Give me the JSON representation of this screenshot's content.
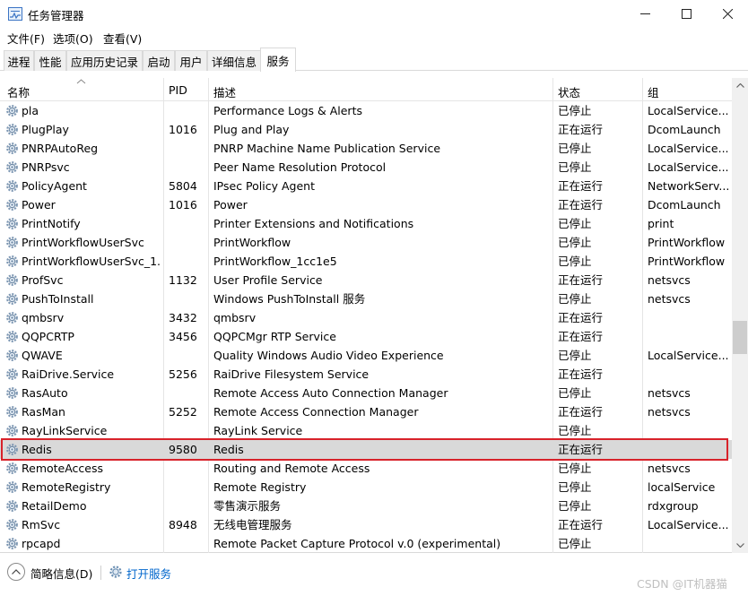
{
  "window": {
    "title": "任务管理器",
    "controls": [
      "minimize",
      "maximize",
      "close"
    ]
  },
  "menu": [
    "文件(F)",
    "选项(O)",
    "查看(V)"
  ],
  "tabs": [
    "进程",
    "性能",
    "应用历史记录",
    "启动",
    "用户",
    "详细信息",
    "服务"
  ],
  "active_tab": "服务",
  "table": {
    "columns": [
      "名称",
      "PID",
      "描述",
      "状态",
      "组"
    ],
    "sort_column": "名称",
    "rows": [
      {
        "name": "pla",
        "pid": "",
        "desc": "Performance Logs & Alerts",
        "status": "已停止",
        "group": "LocalService..."
      },
      {
        "name": "PlugPlay",
        "pid": "1016",
        "desc": "Plug and Play",
        "status": "正在运行",
        "group": "DcomLaunch"
      },
      {
        "name": "PNRPAutoReg",
        "pid": "",
        "desc": "PNRP Machine Name Publication Service",
        "status": "已停止",
        "group": "LocalService..."
      },
      {
        "name": "PNRPsvc",
        "pid": "",
        "desc": "Peer Name Resolution Protocol",
        "status": "已停止",
        "group": "LocalService..."
      },
      {
        "name": "PolicyAgent",
        "pid": "5804",
        "desc": "IPsec Policy Agent",
        "status": "正在运行",
        "group": "NetworkServ..."
      },
      {
        "name": "Power",
        "pid": "1016",
        "desc": "Power",
        "status": "正在运行",
        "group": "DcomLaunch"
      },
      {
        "name": "PrintNotify",
        "pid": "",
        "desc": "Printer Extensions and Notifications",
        "status": "已停止",
        "group": "print"
      },
      {
        "name": "PrintWorkflowUserSvc",
        "pid": "",
        "desc": "PrintWorkflow",
        "status": "已停止",
        "group": "PrintWorkflow"
      },
      {
        "name": "PrintWorkflowUserSvc_1...",
        "pid": "",
        "desc": "PrintWorkflow_1cc1e5",
        "status": "已停止",
        "group": "PrintWorkflow"
      },
      {
        "name": "ProfSvc",
        "pid": "1132",
        "desc": "User Profile Service",
        "status": "正在运行",
        "group": "netsvcs"
      },
      {
        "name": "PushToInstall",
        "pid": "",
        "desc": "Windows PushToInstall 服务",
        "status": "已停止",
        "group": "netsvcs"
      },
      {
        "name": "qmbsrv",
        "pid": "3432",
        "desc": "qmbsrv",
        "status": "正在运行",
        "group": ""
      },
      {
        "name": "QQPCRTP",
        "pid": "3456",
        "desc": "QQPCMgr RTP Service",
        "status": "正在运行",
        "group": ""
      },
      {
        "name": "QWAVE",
        "pid": "",
        "desc": "Quality Windows Audio Video Experience",
        "status": "已停止",
        "group": "LocalService..."
      },
      {
        "name": "RaiDrive.Service",
        "pid": "5256",
        "desc": "RaiDrive Filesystem Service",
        "status": "正在运行",
        "group": ""
      },
      {
        "name": "RasAuto",
        "pid": "",
        "desc": "Remote Access Auto Connection Manager",
        "status": "已停止",
        "group": "netsvcs"
      },
      {
        "name": "RasMan",
        "pid": "5252",
        "desc": "Remote Access Connection Manager",
        "status": "正在运行",
        "group": "netsvcs"
      },
      {
        "name": "RayLinkService",
        "pid": "",
        "desc": "RayLink Service",
        "status": "已停止",
        "group": ""
      },
      {
        "name": "Redis",
        "pid": "9580",
        "desc": "Redis",
        "status": "正在运行",
        "group": ""
      },
      {
        "name": "RemoteAccess",
        "pid": "",
        "desc": "Routing and Remote Access",
        "status": "已停止",
        "group": "netsvcs"
      },
      {
        "name": "RemoteRegistry",
        "pid": "",
        "desc": "Remote Registry",
        "status": "已停止",
        "group": "localService"
      },
      {
        "name": "RetailDemo",
        "pid": "",
        "desc": "零售演示服务",
        "status": "已停止",
        "group": "rdxgroup"
      },
      {
        "name": "RmSvc",
        "pid": "8948",
        "desc": "无线电管理服务",
        "status": "正在运行",
        "group": "LocalService..."
      },
      {
        "name": "rpcapd",
        "pid": "",
        "desc": "Remote Packet Capture Protocol v.0 (experimental)",
        "status": "已停止",
        "group": ""
      }
    ],
    "highlighted_row": "Redis"
  },
  "footer": {
    "fewer_details": "简略信息(D)",
    "open_services": "打开服务",
    "watermark": "CSDN @IT机器猫"
  },
  "colors": {
    "highlight_row": "#d9d9d9",
    "selection_border": "#d8222a",
    "link": "#0066cc"
  }
}
